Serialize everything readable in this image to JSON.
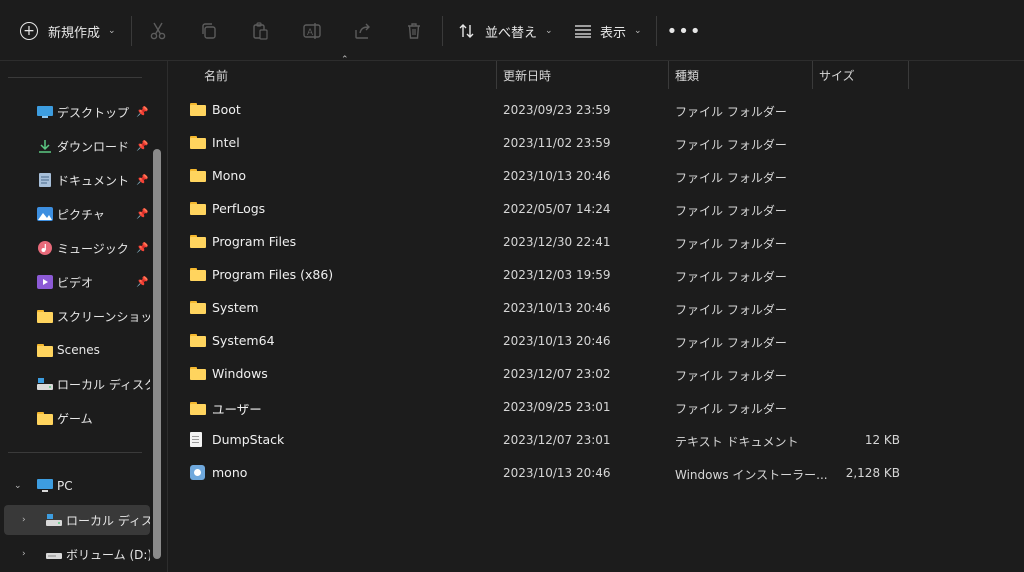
{
  "toolbar": {
    "new_label": "新規作成",
    "sort_label": "並べ替え",
    "view_label": "表示",
    "more_label": "•••",
    "icons": [
      "cut-icon",
      "copy-icon",
      "paste-icon",
      "rename-icon",
      "share-icon",
      "delete-icon"
    ]
  },
  "sidebar": {
    "quick_access": [
      {
        "label": "デスクトップ",
        "icon": "desktop-icon",
        "pinned": true
      },
      {
        "label": "ダウンロード",
        "icon": "download-icon",
        "pinned": true
      },
      {
        "label": "ドキュメント",
        "icon": "documents-icon",
        "pinned": true
      },
      {
        "label": "ピクチャ",
        "icon": "pictures-icon",
        "pinned": true
      },
      {
        "label": "ミュージック",
        "icon": "music-icon",
        "pinned": true
      },
      {
        "label": "ビデオ",
        "icon": "videos-icon",
        "pinned": true
      },
      {
        "label": "スクリーンショット",
        "icon": "folder-icon",
        "pinned": false
      },
      {
        "label": "Scenes",
        "icon": "folder-icon",
        "pinned": false
      },
      {
        "label": "ローカル ディスク (C",
        "icon": "drive-icon",
        "pinned": false
      },
      {
        "label": "ゲーム",
        "icon": "folder-icon",
        "pinned": false
      }
    ],
    "pc_label": "PC",
    "pc_items": [
      {
        "label": "ローカル ディスク (",
        "icon": "drive-icon",
        "selected": true
      },
      {
        "label": "ボリューム (D:)",
        "icon": "drive-icon",
        "selected": false
      }
    ]
  },
  "columns": {
    "name": "名前",
    "date": "更新日時",
    "type": "種類",
    "size": "サイズ"
  },
  "files": [
    {
      "name": "Boot",
      "date": "2023/09/23 23:59",
      "type": "ファイル フォルダー",
      "size": "",
      "icon": "folder-icon"
    },
    {
      "name": "Intel",
      "date": "2023/11/02 23:59",
      "type": "ファイル フォルダー",
      "size": "",
      "icon": "folder-icon"
    },
    {
      "name": "Mono",
      "date": "2023/10/13 20:46",
      "type": "ファイル フォルダー",
      "size": "",
      "icon": "folder-icon"
    },
    {
      "name": "PerfLogs",
      "date": "2022/05/07 14:24",
      "type": "ファイル フォルダー",
      "size": "",
      "icon": "folder-icon"
    },
    {
      "name": "Program Files",
      "date": "2023/12/30 22:41",
      "type": "ファイル フォルダー",
      "size": "",
      "icon": "folder-icon"
    },
    {
      "name": "Program Files (x86)",
      "date": "2023/12/03 19:59",
      "type": "ファイル フォルダー",
      "size": "",
      "icon": "folder-icon"
    },
    {
      "name": "System",
      "date": "2023/10/13 20:46",
      "type": "ファイル フォルダー",
      "size": "",
      "icon": "folder-icon"
    },
    {
      "name": "System64",
      "date": "2023/10/13 20:46",
      "type": "ファイル フォルダー",
      "size": "",
      "icon": "folder-icon"
    },
    {
      "name": "Windows",
      "date": "2023/12/07 23:02",
      "type": "ファイル フォルダー",
      "size": "",
      "icon": "folder-icon"
    },
    {
      "name": "ユーザー",
      "date": "2023/09/25 23:01",
      "type": "ファイル フォルダー",
      "size": "",
      "icon": "folder-icon"
    },
    {
      "name": "DumpStack",
      "date": "2023/12/07 23:01",
      "type": "テキスト ドキュメント",
      "size": "12 KB",
      "icon": "text-file-icon"
    },
    {
      "name": "mono",
      "date": "2023/10/13 20:46",
      "type": "Windows インストーラー...",
      "size": "2,128 KB",
      "icon": "installer-icon"
    }
  ],
  "colors": {
    "background": "#1c1c1c",
    "folder": "#ffd45e",
    "selected": "#393939",
    "text": "#e6e6e6"
  }
}
